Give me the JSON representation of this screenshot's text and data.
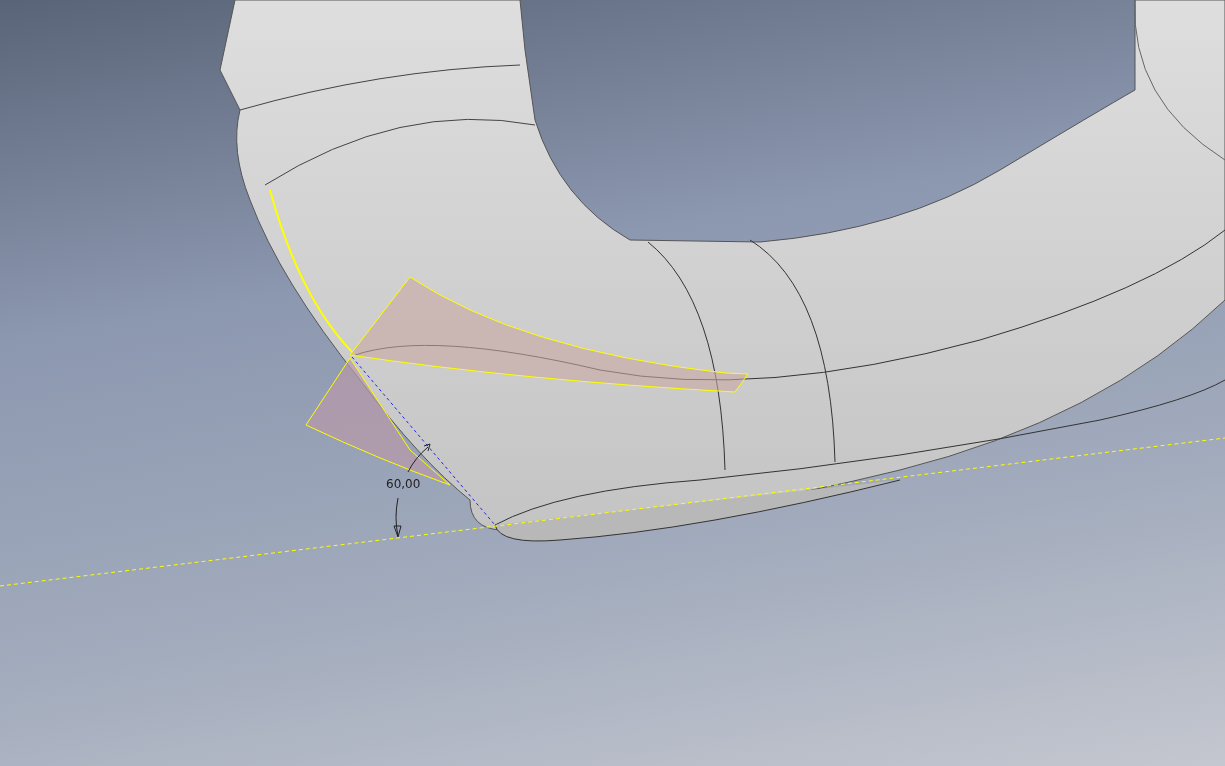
{
  "viewport": {
    "dimension": {
      "value": "60,00"
    }
  }
}
